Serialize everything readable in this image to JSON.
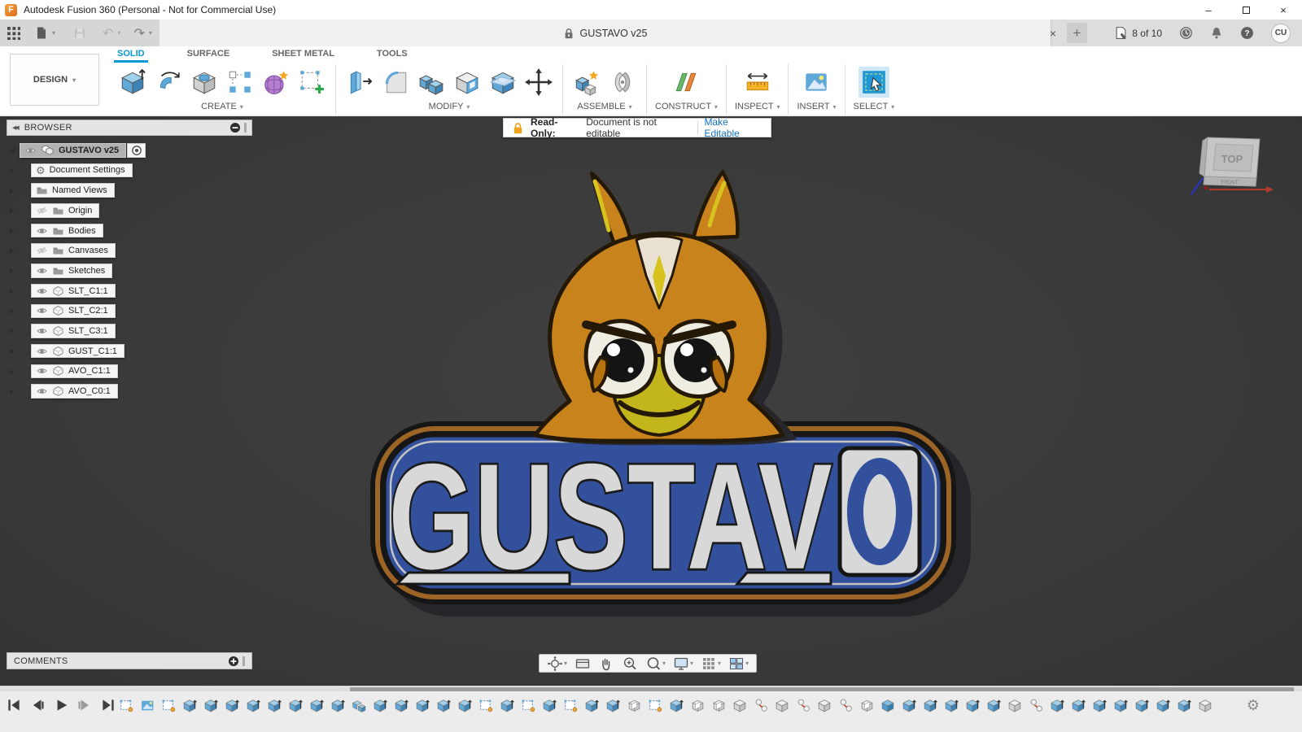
{
  "window": {
    "title": "Autodesk Fusion 360 (Personal - Not for Commercial Use)",
    "logo_letter": "F"
  },
  "glyphs": {
    "caret": "▾",
    "minimize": "–",
    "close_window": "×",
    "close_tab": "×",
    "new_tab": "+",
    "collapse_left": "◀◀",
    "expander": "▶",
    "root_expander": "◢",
    "undo": "↶",
    "redo": "↷",
    "gear": "⚙"
  },
  "tabstrip": {
    "document_title": "GUSTAVO v25",
    "job_status": "8 of 10",
    "avatar_initials": "CU"
  },
  "ribbon": {
    "design_label": "DESIGN",
    "tabs": [
      {
        "label": "SOLID",
        "active": true
      },
      {
        "label": "SURFACE",
        "active": false
      },
      {
        "label": "SHEET METAL",
        "active": false
      },
      {
        "label": "TOOLS",
        "active": false
      }
    ],
    "groups": [
      {
        "label": "CREATE",
        "items": [
          "extrude",
          "revolve",
          "hole",
          "rectangular-pattern",
          "create-form",
          "create-sketch"
        ]
      },
      {
        "label": "MODIFY",
        "items": [
          "press-pull",
          "fillet",
          "combine",
          "shell",
          "split-body",
          "move"
        ]
      },
      {
        "label": "ASSEMBLE",
        "items": [
          "new-component",
          "joint"
        ]
      },
      {
        "label": "CONSTRUCT",
        "items": [
          "offset-plane"
        ]
      },
      {
        "label": "INSPECT",
        "items": [
          "measure"
        ]
      },
      {
        "label": "INSERT",
        "items": [
          "insert-image"
        ]
      },
      {
        "label": "SELECT",
        "items": [
          "select"
        ]
      }
    ]
  },
  "readonly": {
    "label": "Read-Only:",
    "message": "Document is not editable",
    "action": "Make Editable"
  },
  "browser": {
    "title": "BROWSER",
    "rows": [
      {
        "label": "GUSTAVO v25",
        "icon": "assembly",
        "eye": "on",
        "root": true
      },
      {
        "label": "Document Settings",
        "icon": "gear",
        "eye": "none"
      },
      {
        "label": "Named Views",
        "icon": "folder",
        "eye": "none"
      },
      {
        "label": "Origin",
        "icon": "folder",
        "eye": "off"
      },
      {
        "label": "Bodies",
        "icon": "folder",
        "eye": "on"
      },
      {
        "label": "Canvases",
        "icon": "folder",
        "eye": "off"
      },
      {
        "label": "Sketches",
        "icon": "folder",
        "eye": "on"
      },
      {
        "label": "SLT_C1:1",
        "icon": "component",
        "eye": "on"
      },
      {
        "label": "SLT_C2:1",
        "icon": "component",
        "eye": "on"
      },
      {
        "label": "SLT_C3:1",
        "icon": "component",
        "eye": "on"
      },
      {
        "label": "GUST_C1:1",
        "icon": "component",
        "eye": "on"
      },
      {
        "label": "AVO_C1:1",
        "icon": "component",
        "eye": "on"
      },
      {
        "label": "AVO_C0:1",
        "icon": "component",
        "eye": "on"
      }
    ]
  },
  "viewcube": {
    "top_label": "TOP",
    "front_label": "FRONT"
  },
  "model": {
    "logo_text": "GUSTAV",
    "logo_last_letter": "O"
  },
  "comments": {
    "title": "COMMENTS"
  },
  "navbar": {
    "items": [
      {
        "icon": "orbit",
        "caret": true
      },
      {
        "icon": "look-at",
        "caret": false
      },
      {
        "icon": "pan",
        "caret": false
      },
      {
        "icon": "zoom",
        "caret": false
      },
      {
        "icon": "fit",
        "caret": true
      },
      {
        "icon": "display-settings",
        "caret": true
      },
      {
        "icon": "grid-display",
        "caret": true
      },
      {
        "icon": "viewports",
        "caret": true
      }
    ]
  },
  "timeline": {
    "playback": [
      "go-to-start",
      "step-back",
      "play",
      "step-forward",
      "go-to-end"
    ],
    "features": [
      "sketch",
      "canvas",
      "sketch",
      "extrude",
      "extrude",
      "extrude",
      "extrude",
      "extrude",
      "extrude",
      "extrude",
      "extrude",
      "combine",
      "extrude",
      "extrude",
      "extrude",
      "extrude",
      "extrude",
      "sketch",
      "extrude",
      "sketch",
      "extrude",
      "sketch",
      "extrude",
      "extrude",
      "hollow",
      "sketch",
      "extrude",
      "hollow",
      "hollow",
      "graybox",
      "copy",
      "graybox",
      "copy",
      "graybox",
      "copy",
      "hollow",
      "solid",
      "extrude",
      "extrude",
      "extrude",
      "extrude",
      "extrude",
      "graybox",
      "copy",
      "extrude",
      "extrude",
      "extrude",
      "extrude",
      "extrude",
      "extrude",
      "extrude",
      "graybox"
    ]
  },
  "colors": {
    "accent": "#0a99d6",
    "readonly_lock": "#f2a31d",
    "canvas_bg": "#3b3b3b",
    "plate_blue": "#32509c",
    "plate_rim": "#9c6526",
    "body_orange": "#c8831c",
    "belly_yellow": "#c2b61c",
    "link_blue": "#1673c1"
  }
}
